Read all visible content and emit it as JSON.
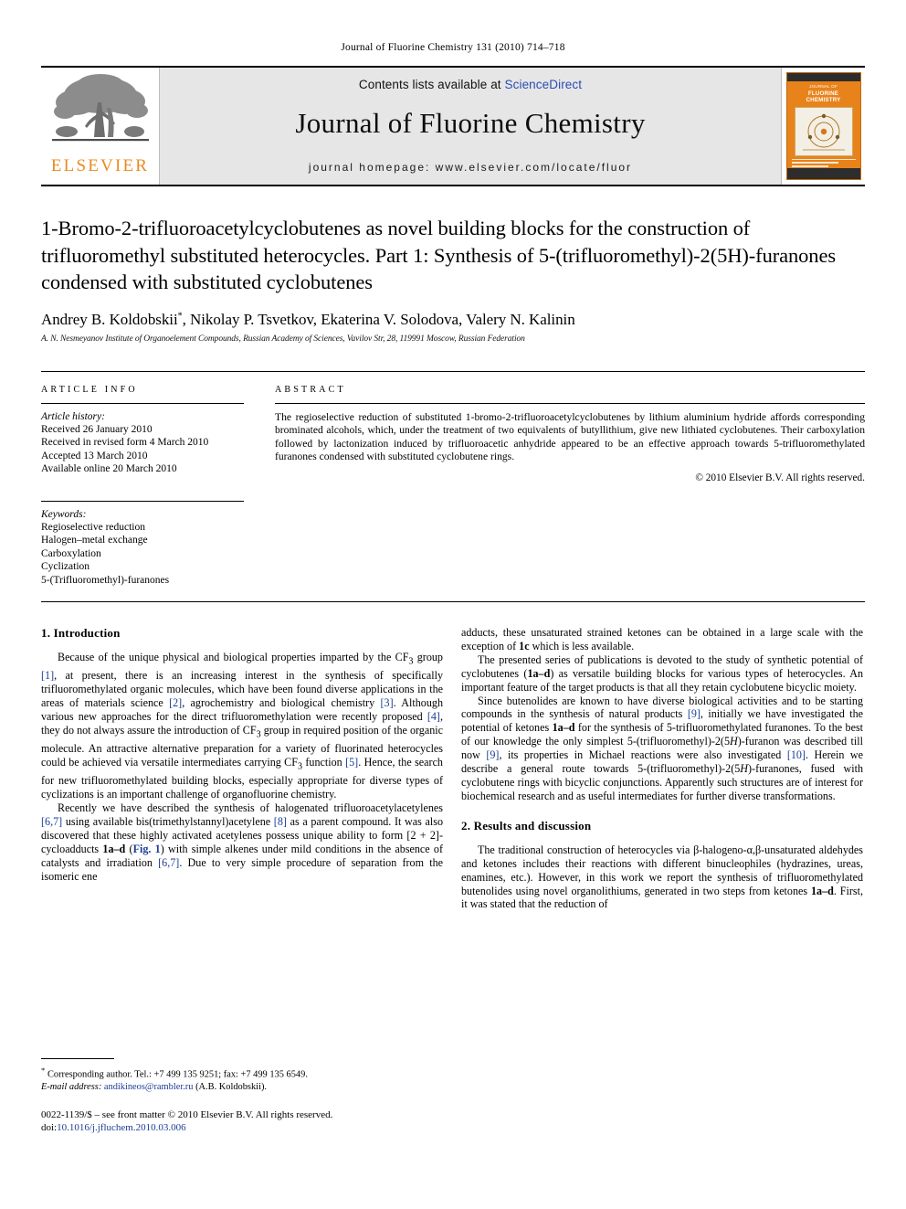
{
  "running_head": "Journal of Fluorine Chemistry 131 (2010) 714–718",
  "masthead": {
    "contents_prefix": "Contents lists available at ",
    "sciencedirect": "ScienceDirect",
    "journal_title": "Journal of Fluorine Chemistry",
    "homepage": "journal homepage: www.elsevier.com/locate/fluor",
    "publisher_wordmark": "ELSEVIER",
    "cover_title_line1": "JOURNAL OF",
    "cover_title_line2": "FLUORINE",
    "cover_title_line3": "CHEMISTRY"
  },
  "article": {
    "title": "1-Bromo-2-trifluoroacetylcyclobutenes as novel building blocks for the construction of trifluoromethyl substituted heterocycles. Part 1: Synthesis of 5-(trifluoromethyl)-2(5H)-furanones condensed with substituted cyclobutenes",
    "authors": "Andrey B. Koldobskii",
    "authors_rest": ", Nikolay P. Tsvetkov, Ekaterina V. Solodova, Valery N. Kalinin",
    "corresponding_marker": "*",
    "affiliation": "A. N. Nesmeyanov Institute of Organoelement Compounds, Russian Academy of Sciences, Vavilov Str, 28, 119991 Moscow, Russian Federation"
  },
  "article_info": {
    "heading": "ARTICLE INFO",
    "history_label": "Article history:",
    "history": [
      "Received 26 January 2010",
      "Received in revised form 4 March 2010",
      "Accepted 13 March 2010",
      "Available online 20 March 2010"
    ],
    "keywords_label": "Keywords:",
    "keywords": [
      "Regioselective reduction",
      "Halogen–metal exchange",
      "Carboxylation",
      "Cyclization",
      "5-(Trifluoromethyl)-furanones"
    ]
  },
  "abstract": {
    "heading": "ABSTRACT",
    "text": "The regioselective reduction of substituted 1-bromo-2-trifluoroacetylcyclobutenes by lithium aluminium hydride affords corresponding brominated alcohols, which, under the treatment of two equivalents of butyllithium, give new lithiated cyclobutenes. Their carboxylation followed by lactonization induced by trifluoroacetic anhydride appeared to be an effective approach towards 5-trifluoromethylated furanones condensed with substituted cyclobutene rings.",
    "copyright": "© 2010 Elsevier B.V. All rights reserved."
  },
  "sections": {
    "introduction_heading": "1. Introduction",
    "results_heading": "2. Results and discussion"
  },
  "paragraphs": {
    "intro_p1_a": "Because of the unique physical and biological properties imparted by the CF",
    "intro_p1_sub": "3",
    "intro_p1_b": " group ",
    "intro_p1_ref1": "[1]",
    "intro_p1_c": ", at present, there is an increasing interest in the synthesis of specifically trifluoromethylated organic molecules, which have been found diverse applications in the areas of materials science ",
    "intro_p1_ref2": "[2]",
    "intro_p1_d": ", agrochemistry and biological chemistry ",
    "intro_p1_ref3": "[3]",
    "intro_p1_e": ". Although various new approaches for the direct trifluoromethylation were recently proposed ",
    "intro_p1_ref4": "[4]",
    "intro_p1_f": ", they do not always assure the introduction of CF",
    "intro_p1_g": " group in required position of the organic molecule. An attractive alternative preparation for a variety of fluorinated heterocycles could be achieved via versatile intermediates carrying CF",
    "intro_p1_h": " function ",
    "intro_p1_ref5": "[5]",
    "intro_p1_i": ". Hence, the search for new trifluoromethylated building blocks, especially appropriate for diverse types of cyclizations is an important challenge of organofluorine chemistry.",
    "intro_p2_a": "Recently we have described the synthesis of halogenated trifluoroacetylacetylenes ",
    "intro_p2_ref67": "[6,7]",
    "intro_p2_b": " using available bis(trimethylstannyl)acetylene ",
    "intro_p2_ref8": "[8]",
    "intro_p2_c": " as a parent compound. It was also discovered that these highly activated acetylenes possess unique ability to form [2 + 2]-cycloadducts ",
    "intro_p2_bold1": "1a–d",
    "intro_p2_d": " (",
    "intro_p2_fig": "Fig. 1",
    "intro_p2_e": ") with simple alkenes under mild conditions in the absence of catalysts and irradiation ",
    "intro_p2_ref67b": "[6,7]",
    "intro_p2_f": ". Due to very simple procedure of separation from the isomeric ene",
    "right_p1_a": "adducts, these unsaturated strained ketones can be obtained in a large scale with the exception of ",
    "right_p1_bold": "1c",
    "right_p1_b": " which is less available.",
    "right_p2_a": "The presented series of publications is devoted to the study of synthetic potential of cyclobutenes (",
    "right_p2_bold": "1a–d",
    "right_p2_b": ") as versatile building blocks for various types of heterocycles. An important feature of the target products is that all they retain cyclobutene bicyclic moiety.",
    "right_p3_a": "Since butenolides are known to have diverse biological activities and to be starting compounds in the synthesis of natural products ",
    "right_p3_ref9": "[9]",
    "right_p3_b": ", initially we have investigated the potential of ketones ",
    "right_p3_bold1": "1a–d",
    "right_p3_c": " for the synthesis of 5-trifluoromethylated furanones. To the best of our knowledge the only simplest 5-(trifluoromethyl)-2(5",
    "right_p3_ital1": "H",
    "right_p3_d": ")-furanon was described till now ",
    "right_p3_ref9b": "[9]",
    "right_p3_e": ", its properties in Michael reactions were also investigated ",
    "right_p3_ref10": "[10]",
    "right_p3_f": ". Herein we describe a general route towards 5-(trifluoromethyl)-2(5",
    "right_p3_ital2": "H",
    "right_p3_g": ")-furanones, fused with cyclobutene rings with bicyclic conjunctions. Apparently such structures are of interest for biochemical research and as useful intermediates for further diverse transformations.",
    "results_p1_a": "The traditional construction of heterocycles via β-halogeno-α,β-unsaturated aldehydes and ketones includes their reactions with different binucleophiles (hydrazines, ureas, enamines, etc.). However, in this work we report the synthesis of trifluoromethylated butenolides using novel organolithiums, generated in two steps from ketones ",
    "results_p1_bold": "1a–d",
    "results_p1_b": ". First, it was stated that the reduction of"
  },
  "footnote": {
    "marker": "*",
    "corresponding": "Corresponding author. Tel.: +7 499 135 9251; fax: +7 499 135 6549.",
    "email_label": "E-mail address:",
    "email": "andikineos@rambler.ru",
    "email_owner": "(A.B. Koldobskii)."
  },
  "footer": {
    "issn_line": "0022-1139/$ – see front matter © 2010 Elsevier B.V. All rights reserved.",
    "doi_label": "doi:",
    "doi": "10.1016/j.jfluchem.2010.03.006"
  }
}
